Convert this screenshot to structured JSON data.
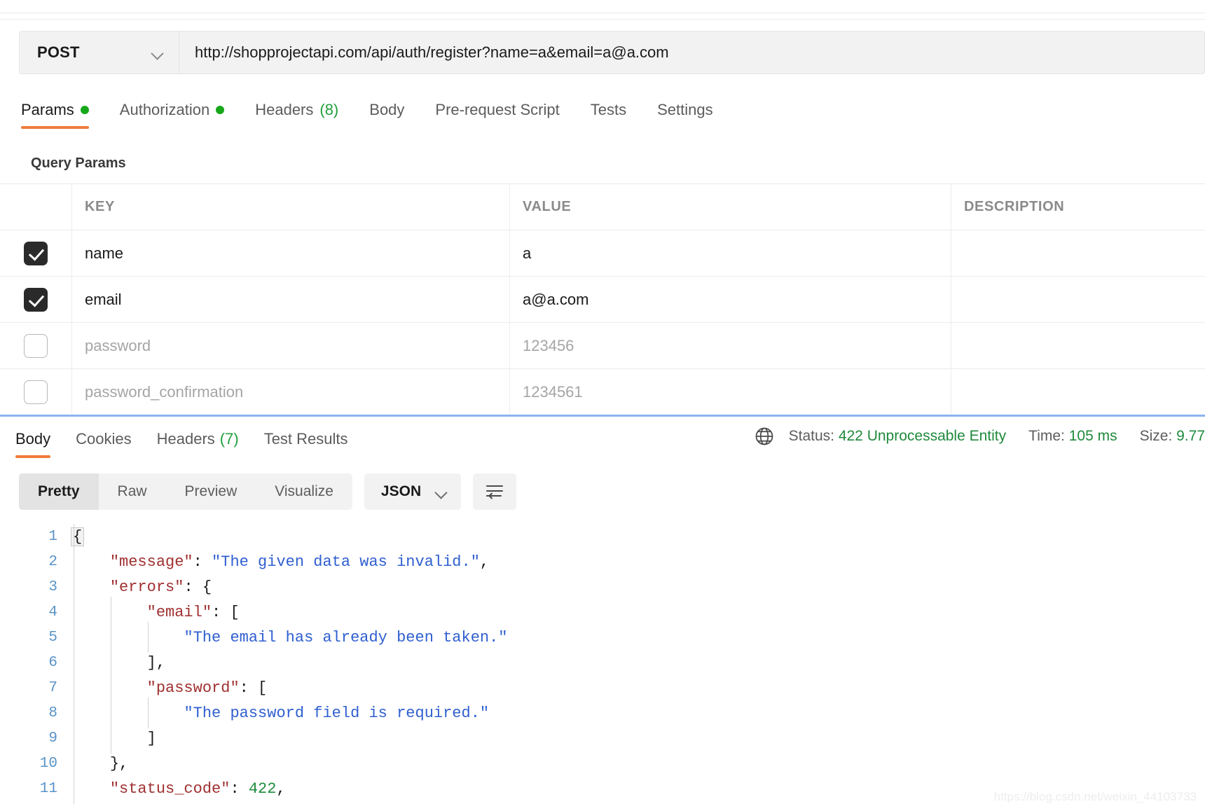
{
  "request": {
    "method": "POST",
    "method_icon": "chevron-down-icon",
    "url": "http://shopprojectapi.com/api/auth/register?name=a&email=a@a.com",
    "url_placeholder": "Enter request URL",
    "tabs": [
      {
        "label": "Params",
        "indicator": "dot",
        "active": true
      },
      {
        "label": "Authorization",
        "indicator": "dot",
        "active": false
      },
      {
        "label": "Headers",
        "count": "(8)",
        "active": false
      },
      {
        "label": "Body",
        "active": false
      },
      {
        "label": "Pre-request Script",
        "active": false
      },
      {
        "label": "Tests",
        "active": false
      },
      {
        "label": "Settings",
        "active": false
      }
    ]
  },
  "query_params": {
    "section_title": "Query Params",
    "columns": [
      "KEY",
      "VALUE",
      "DESCRIPTION"
    ],
    "rows": [
      {
        "checked": true,
        "key": "name",
        "value": "a",
        "description": "",
        "placeholder": false
      },
      {
        "checked": true,
        "key": "email",
        "value": "a@a.com",
        "description": "",
        "placeholder": false
      },
      {
        "checked": false,
        "key": "password",
        "value": "123456",
        "description": "",
        "placeholder": true
      },
      {
        "checked": false,
        "key": "password_confirmation",
        "value": "1234561",
        "description": "",
        "placeholder": true
      }
    ]
  },
  "response": {
    "tabs": [
      {
        "label": "Body",
        "active": true
      },
      {
        "label": "Cookies",
        "active": false
      },
      {
        "label": "Headers",
        "count": "(7)",
        "active": false
      },
      {
        "label": "Test Results",
        "active": false
      }
    ],
    "status": {
      "globe_icon": "globe-icon",
      "status_label": "Status:",
      "status_value": "422 Unprocessable Entity",
      "time_label": "Time:",
      "time_value": "105 ms",
      "size_label": "Size:",
      "size_value": "9.77"
    },
    "toolbar": {
      "views": [
        {
          "label": "Pretty",
          "active": true
        },
        {
          "label": "Raw",
          "active": false
        },
        {
          "label": "Preview",
          "active": false
        },
        {
          "label": "Visualize",
          "active": false
        }
      ],
      "format": "JSON",
      "format_icon": "chevron-down-icon",
      "wrap_icon": "word-wrap-icon"
    },
    "code": {
      "language": "json",
      "lines": [
        {
          "n": "1",
          "indent": 0,
          "tokens": [
            {
              "t": "fold",
              "v": "{"
            }
          ]
        },
        {
          "n": "2",
          "indent": 1,
          "tokens": [
            {
              "t": "key",
              "v": "\"message\""
            },
            {
              "t": "pun",
              "v": ": "
            },
            {
              "t": "str",
              "v": "\"The given data was invalid.\""
            },
            {
              "t": "pun",
              "v": ","
            }
          ]
        },
        {
          "n": "3",
          "indent": 1,
          "tokens": [
            {
              "t": "key",
              "v": "\"errors\""
            },
            {
              "t": "pun",
              "v": ": {"
            }
          ]
        },
        {
          "n": "4",
          "indent": 2,
          "tokens": [
            {
              "t": "key",
              "v": "\"email\""
            },
            {
              "t": "pun",
              "v": ": ["
            }
          ]
        },
        {
          "n": "5",
          "indent": 3,
          "tokens": [
            {
              "t": "str",
              "v": "\"The email has already been taken.\""
            }
          ]
        },
        {
          "n": "6",
          "indent": 2,
          "tokens": [
            {
              "t": "pun",
              "v": "],"
            }
          ]
        },
        {
          "n": "7",
          "indent": 2,
          "tokens": [
            {
              "t": "key",
              "v": "\"password\""
            },
            {
              "t": "pun",
              "v": ": ["
            }
          ]
        },
        {
          "n": "8",
          "indent": 3,
          "tokens": [
            {
              "t": "str",
              "v": "\"The password field is required.\""
            }
          ]
        },
        {
          "n": "9",
          "indent": 2,
          "tokens": [
            {
              "t": "pun",
              "v": "]"
            }
          ]
        },
        {
          "n": "10",
          "indent": 1,
          "tokens": [
            {
              "t": "pun",
              "v": "},"
            }
          ]
        },
        {
          "n": "11",
          "indent": 1,
          "tokens": [
            {
              "t": "key",
              "v": "\"status_code\""
            },
            {
              "t": "pun",
              "v": ": "
            },
            {
              "t": "num",
              "v": "422"
            },
            {
              "t": "pun",
              "v": ","
            }
          ]
        }
      ]
    }
  },
  "watermark": "https://blog.csdn.net/weixin_44103733",
  "colors": {
    "accent": "#ef7c3c",
    "success": "#1f8a3c",
    "splitter": "#8ab4f0",
    "json_key": "#a03030",
    "json_string": "#2f5fd0",
    "json_number": "#1f8a3c",
    "line_number": "#5a93c6"
  }
}
